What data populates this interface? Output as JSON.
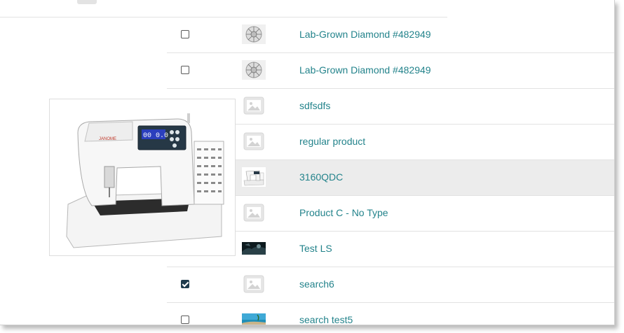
{
  "products": [
    {
      "checked": false,
      "thumb": "diamond-icon",
      "name": "Lab-Grown Diamond #482949"
    },
    {
      "checked": false,
      "thumb": "diamond-icon",
      "name": "Lab-Grown Diamond #482949"
    },
    {
      "checked": false,
      "thumb": "image-placeholder-icon",
      "name": "sdfsdfs"
    },
    {
      "checked": false,
      "thumb": "image-placeholder-icon",
      "name": "regular product"
    },
    {
      "checked": false,
      "thumb": "sewing-machine-thumbnail",
      "name": "3160QDC",
      "hovered": true
    },
    {
      "checked": false,
      "thumb": "image-placeholder-icon",
      "name": "Product C - No Type"
    },
    {
      "checked": false,
      "thumb": "dark-photo-thumbnail",
      "name": "Test LS"
    },
    {
      "checked": true,
      "thumb": "image-placeholder-icon",
      "name": "search6"
    },
    {
      "checked": false,
      "thumb": "beach-photo-thumbnail",
      "name": "search test5"
    }
  ],
  "preview": {
    "image": "sewing-machine-image",
    "brand": "JANOME",
    "display": "00 0.0"
  },
  "colors": {
    "link": "#23838b",
    "hover_row": "#ececec",
    "checkbox_checked": "#1f3b4d"
  }
}
